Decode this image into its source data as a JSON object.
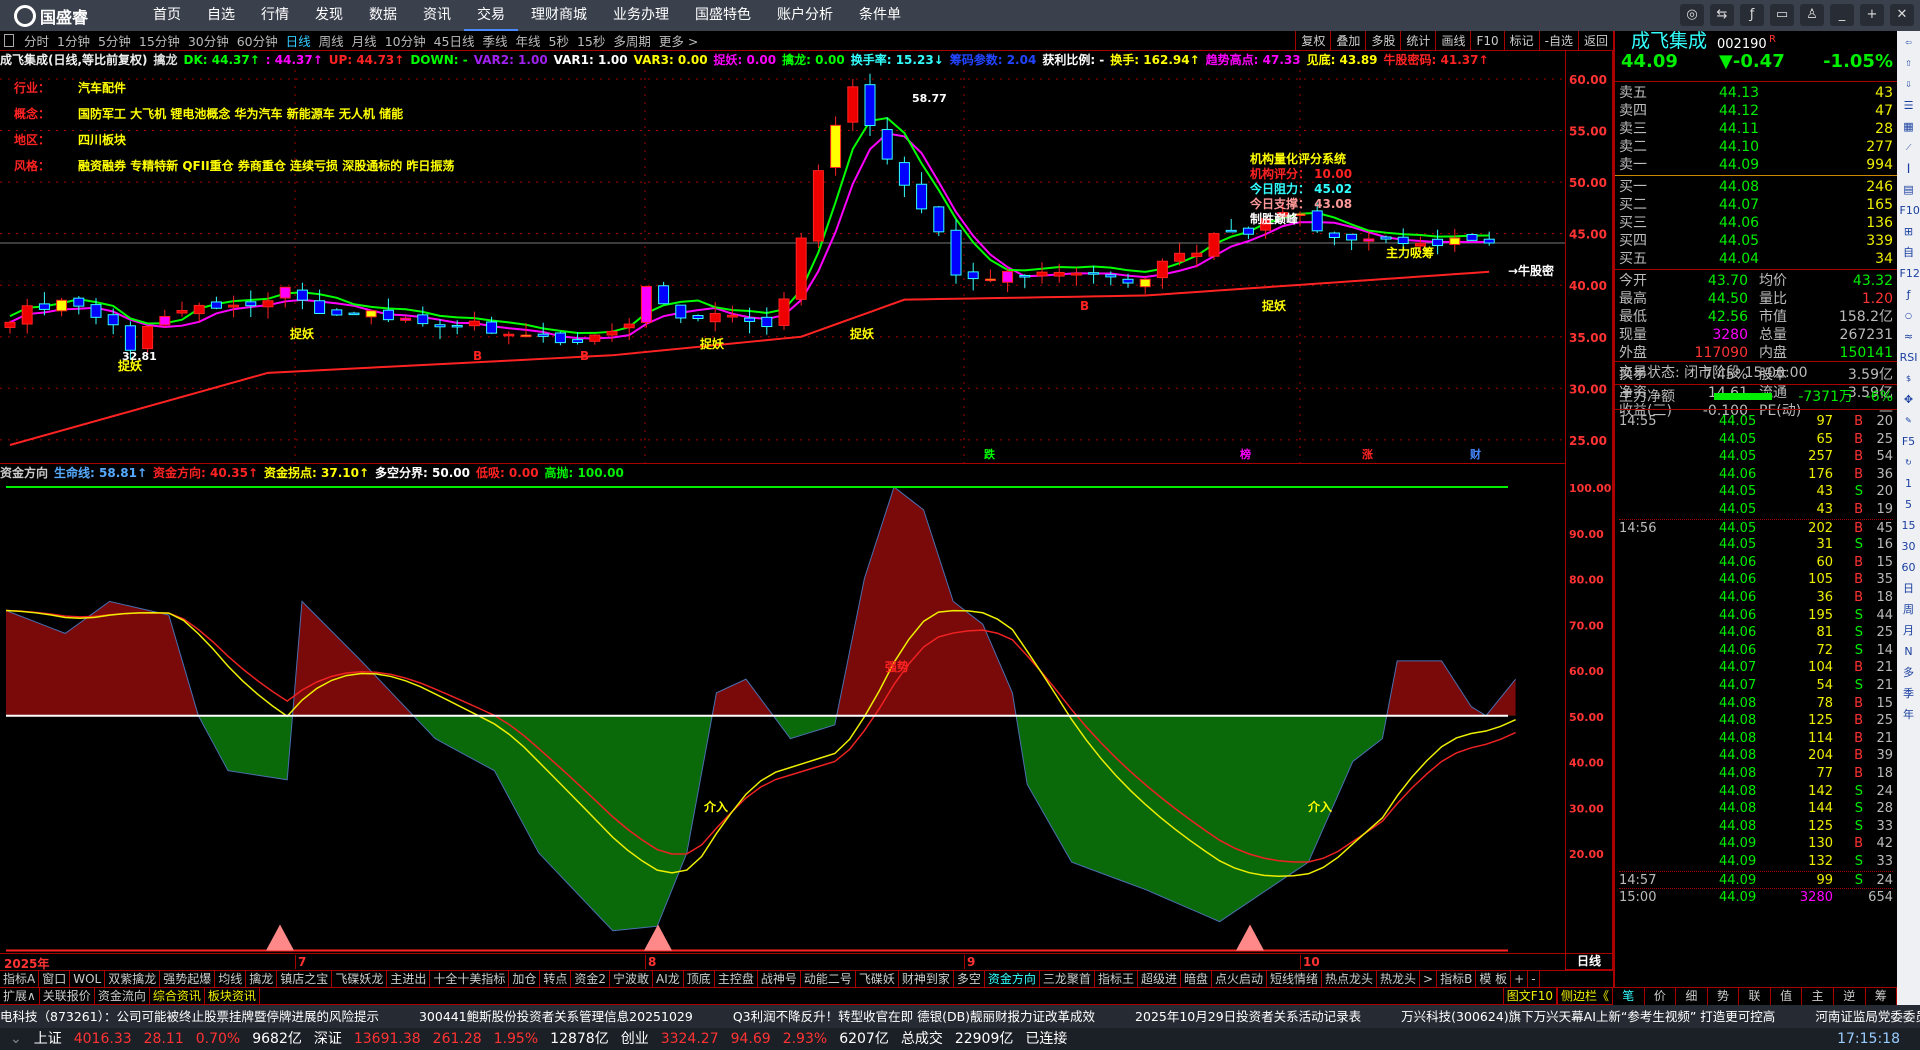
{
  "app": {
    "logo": "国盛睿",
    "menu": [
      "首页",
      "自选",
      "行情",
      "发现",
      "数据",
      "资讯",
      "交易",
      "理财商城",
      "业务办理",
      "国盛特色",
      "账户分析",
      "条件单"
    ],
    "active_menu": "交易",
    "window_buttons": [
      "chat-icon",
      "swap-icon",
      "fx-icon",
      "monitor-icon",
      "shirt-icon",
      "minimize-icon",
      "pin-icon",
      "close-icon"
    ]
  },
  "periods": [
    "分时",
    "1分钟",
    "5分钟",
    "15分钟",
    "30分钟",
    "60分钟",
    "日线",
    "周线",
    "月线",
    "10分钟",
    "45日线",
    "季线",
    "年线",
    "5秒",
    "15秒",
    "多周期",
    "更多 >"
  ],
  "active_period": "日线",
  "right_tools": [
    "复权",
    "叠加",
    "多股",
    "统计",
    "画线",
    "F10",
    "标记",
    "-自选",
    "返回"
  ],
  "main_header": [
    {
      "t": "成飞集成(日线,等比前复权)",
      "c": "#f0f0f0"
    },
    {
      "t": "擒龙",
      "c": "#ddd"
    },
    {
      "t": "DK: 44.37↑",
      "c": "#0f0"
    },
    {
      "t": ": 44.37↑",
      "c": "#f0f"
    },
    {
      "t": "UP: 44.73↑",
      "c": "#f22"
    },
    {
      "t": "DOWN: -",
      "c": "#0f0"
    },
    {
      "t": "VAR2: 1.00",
      "c": "#a020f0"
    },
    {
      "t": "VAR1: 1.00",
      "c": "#fff"
    },
    {
      "t": "VAR3: 0.00",
      "c": "#ff0"
    },
    {
      "t": "捉妖: 0.00",
      "c": "#f0f"
    },
    {
      "t": "擒龙: 0.00",
      "c": "#0f0"
    },
    {
      "t": "换手率: 15.23↓",
      "c": "#3ff"
    },
    {
      "t": "筹码参数: 2.04",
      "c": "#24f"
    },
    {
      "t": "获利比例: -",
      "c": "#fff"
    },
    {
      "t": "换手: 162.94↑",
      "c": "#ff0"
    },
    {
      "t": "趋势高点: 47.33",
      "c": "#f0f"
    },
    {
      "t": "见底: 43.89",
      "c": "#ff0"
    },
    {
      "t": "牛股密码: 41.37↑",
      "c": "#f22"
    }
  ],
  "info_panel": [
    {
      "label": "行业：",
      "value": "汽车配件"
    },
    {
      "label": "概念：",
      "value": "国防军工 大飞机 锂电池概念 华为汽车 新能源车 无人机 储能"
    },
    {
      "label": "地区：",
      "value": "四川板块"
    },
    {
      "label": "风格：",
      "value": "融资融券 专精特新 QFII重仓 券商重仓 连续亏损 深股通标的 昨日振荡"
    }
  ],
  "score_panel": {
    "title": "机构量化评分系统",
    "score": "机构评分：  10.00",
    "resist": "今日阻力：  45.02",
    "support": "今日支撑：  43.08",
    "tag": "制胜巅峰"
  },
  "annotations": {
    "peak": "58.77",
    "low": "32.81",
    "zhuyao": "捉妖",
    "xichou": "主力吸筹",
    "niugu": "→牛股密",
    "b": "B",
    "bottom_tags": [
      "跌",
      "榜",
      "涨",
      "财"
    ]
  },
  "lower_header": [
    {
      "t": "资金方向",
      "c": "#ccc"
    },
    {
      "t": "生命线: 58.81↑",
      "c": "#5af"
    },
    {
      "t": "资金方向: 40.35↑",
      "c": "#f22"
    },
    {
      "t": "资金拐点: 37.10↑",
      "c": "#ff0"
    },
    {
      "t": "多空分界: 50.00",
      "c": "#fff"
    },
    {
      "t": "低吸: 0.00",
      "c": "#f22"
    },
    {
      "t": "高抛: 100.00",
      "c": "#0e0"
    }
  ],
  "lower_annotations": {
    "jieru": "介入",
    "qiangshi": "强势"
  },
  "chart_data": [
    {
      "type": "candlestick",
      "title": "成飞集成 日线",
      "ylim": [
        22,
        62
      ],
      "yticks": [
        "60.00",
        "55.00",
        "50.00",
        "45.00",
        "40.00",
        "35.00",
        "30.00",
        "25.00"
      ],
      "xticks": [
        "2025年",
        "7",
        "8",
        "9",
        "10"
      ],
      "close_keypoints": [
        [
          0,
          37
        ],
        [
          3,
          38.5
        ],
        [
          6,
          36
        ],
        [
          7,
          34
        ],
        [
          9,
          37.5
        ],
        [
          15,
          38
        ],
        [
          16,
          40
        ],
        [
          18,
          37.5
        ],
        [
          25,
          36.5
        ],
        [
          33,
          34.5
        ],
        [
          36,
          36
        ],
        [
          37,
          40
        ],
        [
          39,
          37
        ],
        [
          44,
          36.5
        ],
        [
          45,
          39
        ],
        [
          46,
          45
        ],
        [
          47,
          51
        ],
        [
          48,
          55
        ],
        [
          49,
          58.77
        ],
        [
          50,
          55
        ],
        [
          52,
          50
        ],
        [
          53,
          48
        ],
        [
          54,
          45.5
        ],
        [
          55,
          41
        ],
        [
          66,
          40.5
        ],
        [
          67,
          42
        ],
        [
          70,
          44.5
        ],
        [
          73,
          46
        ],
        [
          75,
          47
        ],
        [
          76,
          45
        ],
        [
          78,
          44.5
        ],
        [
          85,
          43.9
        ],
        [
          86,
          44.09
        ]
      ],
      "long_ma_keypoints": [
        [
          0,
          24.5
        ],
        [
          15,
          31.5
        ],
        [
          35,
          33.2
        ],
        [
          46,
          35
        ],
        [
          52,
          38.6
        ],
        [
          66,
          39
        ],
        [
          86,
          41.3
        ]
      ],
      "last_price": "44.09"
    },
    {
      "type": "area",
      "title": "资金方向",
      "ylim": [
        0,
        100
      ],
      "yticks": [
        "100.00",
        "90.00",
        "80.00",
        "70.00",
        "60.00",
        "50.00",
        "40.00",
        "30.00",
        "20.00"
      ],
      "baseline": 50,
      "series_keypoints": [
        [
          0,
          73
        ],
        [
          4,
          68
        ],
        [
          7,
          75
        ],
        [
          11,
          72
        ],
        [
          13,
          50
        ],
        [
          15,
          38
        ],
        [
          17,
          37
        ],
        [
          19,
          36
        ],
        [
          20,
          75
        ],
        [
          24,
          62
        ],
        [
          29,
          45
        ],
        [
          33,
          38
        ],
        [
          36,
          20
        ],
        [
          41,
          3
        ],
        [
          44,
          4
        ],
        [
          46,
          20
        ],
        [
          48,
          55
        ],
        [
          50,
          58
        ],
        [
          53,
          45
        ],
        [
          56,
          48
        ],
        [
          58,
          80
        ],
        [
          60,
          100
        ],
        [
          62,
          95
        ],
        [
          64,
          75
        ],
        [
          66,
          70
        ],
        [
          68,
          55
        ],
        [
          69,
          35
        ],
        [
          72,
          18
        ],
        [
          77,
          12
        ],
        [
          82,
          5
        ],
        [
          88,
          18
        ],
        [
          91,
          40
        ],
        [
          93,
          45
        ],
        [
          94,
          62
        ],
        [
          97,
          62
        ],
        [
          99,
          52
        ],
        [
          100,
          50
        ],
        [
          102,
          58
        ]
      ]
    }
  ],
  "side_icons": [
    "arrow-left-icon",
    "arrow-up-icon",
    "arrow-down-icon",
    "list-icon",
    "grid-icon",
    "line-chart-icon",
    "candle-icon",
    "docs-icon",
    "f10-icon",
    "tree-icon",
    "self-icon",
    "f12-icon",
    "fx-icon",
    "circle-icon",
    "wave-icon",
    "rsi-icon",
    "dollar-icon",
    "move-icon",
    "pencil-icon",
    "f5-icon",
    "refresh-icon"
  ],
  "side_periods": [
    "1",
    "5",
    "15",
    "30",
    "60",
    "日",
    "周",
    "月",
    "N",
    "多",
    "季",
    "年"
  ],
  "quote": {
    "name": "成飞集成",
    "code": "002190",
    "flag": "R",
    "price": "44.09",
    "change": "▼-0.47",
    "pct": "-1.05%",
    "asks": [
      {
        "l": "卖五",
        "p": "44.13",
        "v": "43"
      },
      {
        "l": "卖四",
        "p": "44.12",
        "v": "47"
      },
      {
        "l": "卖三",
        "p": "44.11",
        "v": "28"
      },
      {
        "l": "卖二",
        "p": "44.10",
        "v": "277"
      },
      {
        "l": "卖一",
        "p": "44.09",
        "v": "994"
      }
    ],
    "bids": [
      {
        "l": "买一",
        "p": "44.08",
        "v": "246"
      },
      {
        "l": "买二",
        "p": "44.07",
        "v": "165"
      },
      {
        "l": "买三",
        "p": "44.06",
        "v": "136"
      },
      {
        "l": "买四",
        "p": "44.05",
        "v": "339"
      },
      {
        "l": "买五",
        "p": "44.04",
        "v": "34"
      }
    ],
    "stats": [
      [
        "今开",
        "43.70",
        "g",
        "均价",
        "43.32",
        "g"
      ],
      [
        "最高",
        "44.50",
        "g",
        "量比",
        "1.20",
        "r"
      ],
      [
        "最低",
        "42.56",
        "g",
        "市值",
        "158.2亿",
        "gr"
      ],
      [
        "现量",
        "3280",
        "m",
        "总量",
        "267231",
        "gr"
      ],
      [
        "外盘",
        "117090",
        "r",
        "内盘",
        "150141",
        "g"
      ],
      [
        "换手",
        "7.45%",
        "gr",
        "股本",
        "3.59亿",
        "gr"
      ],
      [
        "净资",
        "14.61",
        "gr",
        "流通",
        "3.59亿",
        "gr"
      ],
      [
        "收益(三)",
        "-0.100",
        "gr",
        "PE(动)",
        "—",
        "gr"
      ]
    ],
    "trade_status": "交易状态: 闭市阶段 15:00:00",
    "net_label": "主力净额",
    "net_value": "-7371万",
    "net_pct": "-6%"
  },
  "ticks": [
    [
      "14:55",
      "44.05",
      "97",
      "B",
      "20"
    ],
    [
      "",
      "44.05",
      "65",
      "B",
      "25"
    ],
    [
      "",
      "44.05",
      "257",
      "B",
      "54"
    ],
    [
      "",
      "44.06",
      "176",
      "B",
      "36"
    ],
    [
      "",
      "44.05",
      "43",
      "S",
      "20"
    ],
    [
      "",
      "44.05",
      "43",
      "B",
      "19"
    ],
    [
      "14:56",
      "44.05",
      "202",
      "B",
      "45"
    ],
    [
      "",
      "44.05",
      "31",
      "S",
      "16"
    ],
    [
      "",
      "44.06",
      "60",
      "B",
      "15"
    ],
    [
      "",
      "44.06",
      "105",
      "B",
      "35"
    ],
    [
      "",
      "44.06",
      "36",
      "B",
      "18"
    ],
    [
      "",
      "44.06",
      "195",
      "S",
      "44"
    ],
    [
      "",
      "44.06",
      "81",
      "S",
      "25"
    ],
    [
      "",
      "44.06",
      "72",
      "S",
      "14"
    ],
    [
      "",
      "44.07",
      "104",
      "B",
      "21"
    ],
    [
      "",
      "44.07",
      "54",
      "S",
      "21"
    ],
    [
      "",
      "44.08",
      "78",
      "B",
      "15"
    ],
    [
      "",
      "44.08",
      "125",
      "B",
      "25"
    ],
    [
      "",
      "44.08",
      "114",
      "B",
      "21"
    ],
    [
      "",
      "44.08",
      "204",
      "B",
      "39"
    ],
    [
      "",
      "44.08",
      "77",
      "B",
      "18"
    ],
    [
      "",
      "44.08",
      "142",
      "S",
      "24"
    ],
    [
      "",
      "44.08",
      "144",
      "S",
      "28"
    ],
    [
      "",
      "44.08",
      "125",
      "S",
      "33"
    ],
    [
      "",
      "44.09",
      "130",
      "B",
      "42"
    ],
    [
      "",
      "44.09",
      "132",
      "S",
      "33"
    ],
    [
      "14:57",
      "44.09",
      "99",
      "S",
      "24"
    ],
    [
      "15:00",
      "44.09",
      "3280",
      "",
      "654"
    ]
  ],
  "right_tabs": [
    "笔",
    "价",
    "细",
    "势",
    "联",
    "值",
    "主",
    "逆",
    "筹"
  ],
  "axis_period": "日线",
  "tabs1": [
    "指标A",
    "窗口",
    "WOL",
    "双紫擒龙",
    "强势起爆",
    "均线",
    "擒龙",
    "镇店之宝",
    "飞碟妖龙",
    "主进出",
    "十全十美指标",
    "加仓",
    "转点",
    "资金2",
    "宁波敢",
    "AI龙",
    "顶底",
    "主控盘",
    "战神号",
    "动能二号",
    "飞碟妖",
    "财神到家",
    "多空",
    "资金方向",
    "三龙聚首",
    "指标王",
    "超级进",
    "暗盘",
    "点火启动",
    "短线情绪",
    "热点龙头",
    "热龙头",
    ">",
    "指标B",
    "模 板",
    "+",
    "-"
  ],
  "active_tab": "资金方向",
  "tabs2": [
    "扩展∧",
    "关联报价",
    "资金流向",
    "综合资讯",
    "板块资讯"
  ],
  "tabs2_right": [
    "图文F10",
    "侧边栏《"
  ],
  "news": [
    "电科技（873261）：公司可能被终止股票挂牌暨停牌进展的风险提示",
    "300441鲍斯股份投资者关系管理信息20251029",
    "Q3利润不降反升！转型收官在即 德银(DB)靓丽财报力证改革成效",
    "2025年10月29日投资者关系活动记录表",
    "万兴科技(300624)旗下万兴天幕AI上新“参考生视频” 打造更可控高",
    "河南证监局党委委员、副局长楚天"
  ],
  "status": {
    "sh_label": "上证",
    "sh": "4016.33",
    "sh_chg": "28.11",
    "sh_pct": "0.70%",
    "sh_amt": "9682亿",
    "sz_label": "深证",
    "sz": "13691.38",
    "sz_chg": "261.28",
    "sz_pct": "1.95%",
    "sz_amt": "12878亿",
    "cy_label": "创业",
    "cy": "3324.27",
    "cy_chg": "94.69",
    "cy_pct": "2.93%",
    "cy_amt": "6207亿",
    "total_label": "总成交",
    "total": "22909亿",
    "conn": "已连接",
    "time": "17:15:18"
  }
}
